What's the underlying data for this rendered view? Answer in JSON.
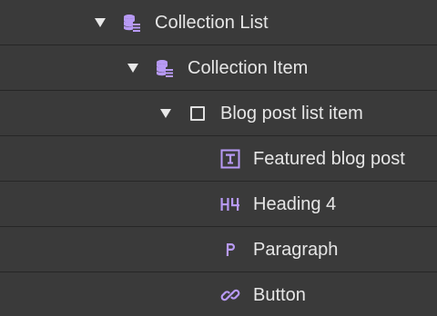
{
  "navigator": {
    "accent_color": "#b89af5",
    "items": [
      {
        "label": "Collection List",
        "icon": "collection-list-icon"
      },
      {
        "label": "Collection Item",
        "icon": "collection-item-icon"
      },
      {
        "label": "Blog post list item",
        "icon": "div-block-icon"
      },
      {
        "label": "Featured blog post",
        "icon": "text-block-icon"
      },
      {
        "label": "Heading 4",
        "icon": "heading-icon",
        "icon_text": "H4"
      },
      {
        "label": "Paragraph",
        "icon": "paragraph-icon",
        "icon_text": "P"
      },
      {
        "label": "Button",
        "icon": "link-icon"
      }
    ]
  }
}
